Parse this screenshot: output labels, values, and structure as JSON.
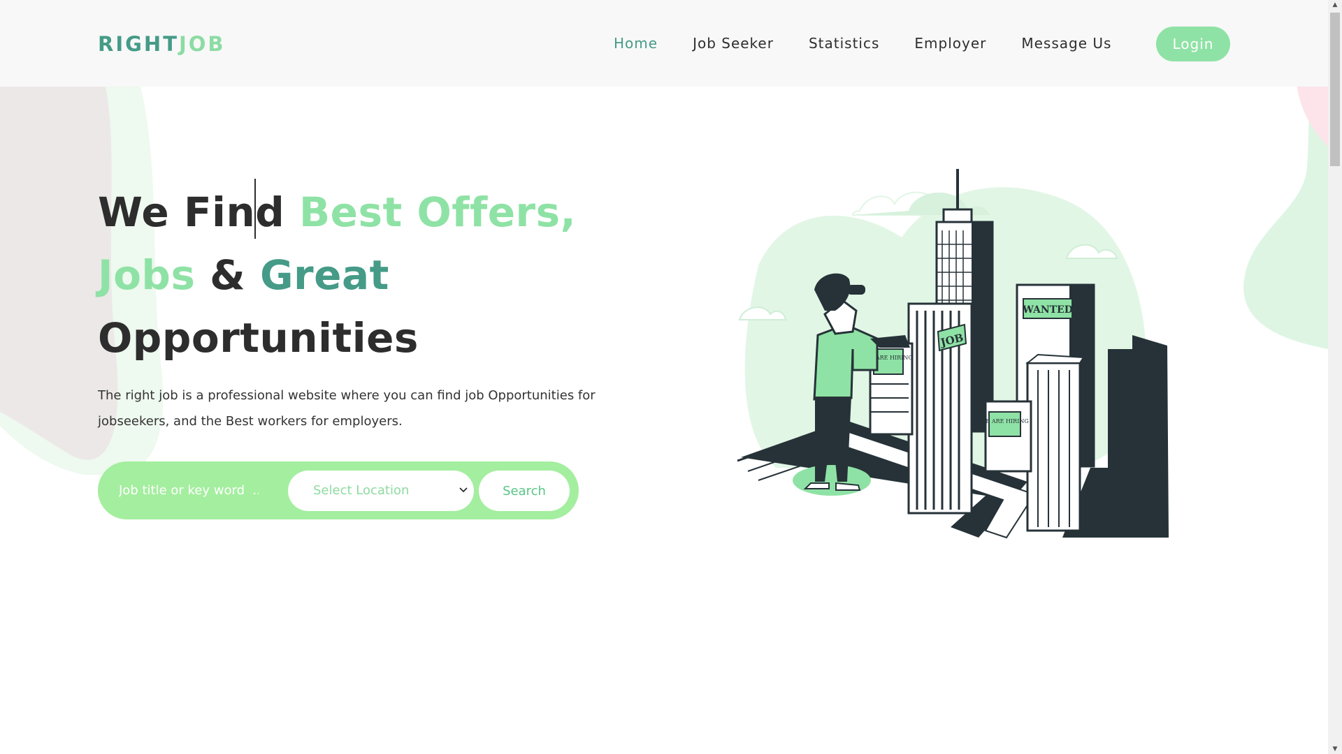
{
  "brand": {
    "part1": "RIGHT",
    "part2": "JOB"
  },
  "nav": {
    "items": [
      {
        "label": "Home",
        "active": true
      },
      {
        "label": "Job Seeker",
        "active": false
      },
      {
        "label": "Statistics",
        "active": false
      },
      {
        "label": "Employer",
        "active": false
      },
      {
        "label": "Message Us",
        "active": false
      }
    ],
    "login_label": "Login"
  },
  "hero": {
    "title_part1": "We Fin",
    "title_part2": "d",
    "title_part3": " Best Offers,",
    "title_part4": "Jobs",
    "title_part5": " & ",
    "title_part6": "Great",
    "title_part7": "Opportunities",
    "description": "The right job is a professional website where you can find job Opportunities for jobseekers, and the Best workers for employers."
  },
  "search": {
    "keyword_placeholder": "Job title or key word  ...",
    "location_selected": "Select Location",
    "button_label": "Search"
  },
  "illustration": {
    "sign_job": "JOB",
    "sign_wanted": "WANTED",
    "sign_hiring_1": "WE ARE HIRING",
    "sign_hiring_2": "WE ARE HIRING"
  },
  "colors": {
    "accent_light": "#8fe2a5",
    "accent_teal": "#459b87",
    "search_bg": "#a4ee9f",
    "dark": "#2d2d2d"
  },
  "icons": [
    "chevron-down-icon",
    "scroll-up-arrow-icon",
    "scroll-down-arrow-icon"
  ]
}
